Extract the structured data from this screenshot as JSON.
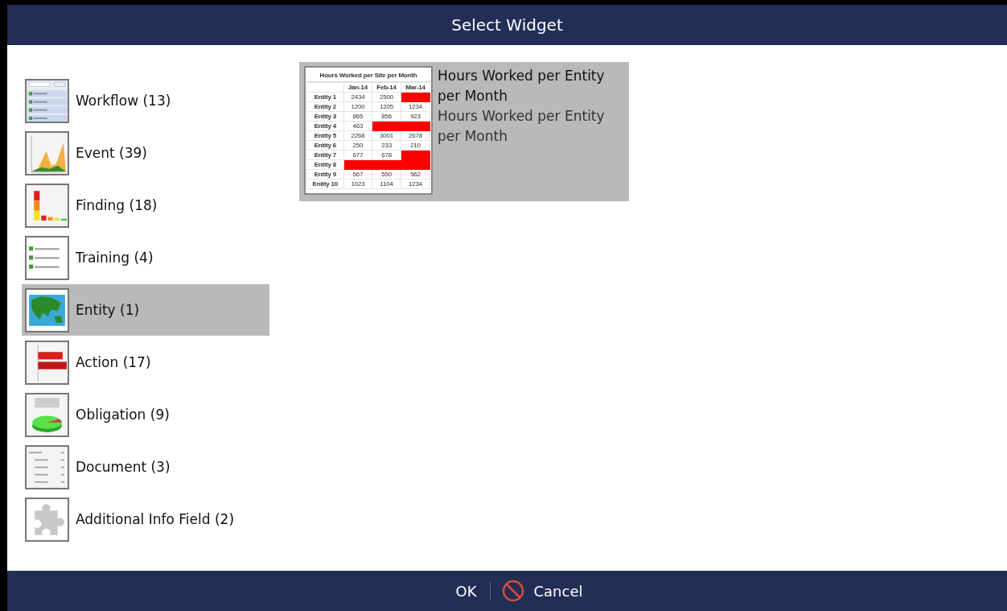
{
  "window": {
    "title": "Select Widget"
  },
  "categories": [
    {
      "label": "Workflow (13)",
      "kind": "list",
      "selected": false
    },
    {
      "label": "Event (39)",
      "kind": "area",
      "selected": false
    },
    {
      "label": "Finding (18)",
      "kind": "bar",
      "selected": false
    },
    {
      "label": "Training (4)",
      "kind": "checklist",
      "selected": false
    },
    {
      "label": "Entity (1)",
      "kind": "map",
      "selected": true
    },
    {
      "label": "Action (17)",
      "kind": "hbar",
      "selected": false
    },
    {
      "label": "Obligation (9)",
      "kind": "pie",
      "selected": false
    },
    {
      "label": "Document (3)",
      "kind": "table",
      "selected": false
    },
    {
      "label": "Additional Info Field (2)",
      "kind": "puzzle",
      "selected": false
    }
  ],
  "widgets": [
    {
      "title": "Hours Worked per Entity per Month",
      "description": "Hours Worked per Entity per Month",
      "preview": {
        "title": "Hours Worked per Site per Month",
        "columns": [
          "Jan-14",
          "Feb-14",
          "Mar-14"
        ],
        "rows": [
          {
            "label": "Entity 1",
            "cells": [
              {
                "kind": "value",
                "text": "2434"
              },
              {
                "kind": "value",
                "text": "2500"
              },
              {
                "kind": "gap"
              }
            ]
          },
          {
            "label": "Entity 2",
            "cells": [
              {
                "kind": "value",
                "text": "1200"
              },
              {
                "kind": "value",
                "text": "1205"
              },
              {
                "kind": "value",
                "text": "1234"
              }
            ]
          },
          {
            "label": "Entity 3",
            "cells": [
              {
                "kind": "value",
                "text": "865"
              },
              {
                "kind": "value",
                "text": "856"
              },
              {
                "kind": "value",
                "text": "923"
              }
            ]
          },
          {
            "label": "Entity 4",
            "cells": [
              {
                "kind": "value",
                "text": "463"
              },
              {
                "kind": "gap"
              },
              {
                "kind": "gap"
              }
            ]
          },
          {
            "label": "Entity 5",
            "cells": [
              {
                "kind": "value",
                "text": "2268"
              },
              {
                "kind": "value",
                "text": "3001"
              },
              {
                "kind": "value",
                "text": "2678"
              }
            ]
          },
          {
            "label": "Entity 6",
            "cells": [
              {
                "kind": "value",
                "text": "250"
              },
              {
                "kind": "value",
                "text": "233"
              },
              {
                "kind": "value",
                "text": "210"
              }
            ]
          },
          {
            "label": "Entity 7",
            "cells": [
              {
                "kind": "value",
                "text": "677"
              },
              {
                "kind": "value",
                "text": "678"
              },
              {
                "kind": "gap"
              }
            ]
          },
          {
            "label": "Entity 8",
            "cells": [
              {
                "kind": "gap"
              },
              {
                "kind": "gap"
              },
              {
                "kind": "gap"
              }
            ]
          },
          {
            "label": "Entity 9",
            "cells": [
              {
                "kind": "value",
                "text": "567"
              },
              {
                "kind": "value",
                "text": "550"
              },
              {
                "kind": "value",
                "text": "562"
              }
            ]
          },
          {
            "label": "Entity 10",
            "cells": [
              {
                "kind": "value",
                "text": "1023"
              },
              {
                "kind": "value",
                "text": "1104"
              },
              {
                "kind": "value",
                "text": "1234"
              }
            ]
          }
        ]
      }
    }
  ],
  "buttons": {
    "ok": "OK",
    "cancel": "Cancel"
  }
}
